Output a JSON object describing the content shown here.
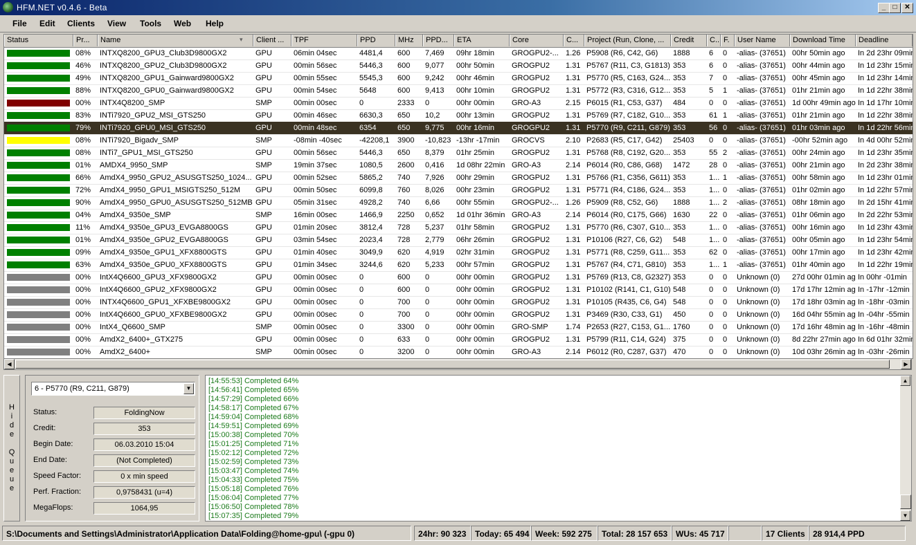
{
  "window": {
    "title": "HFM.NET v0.4.6 - Beta",
    "min": "_",
    "max": "□",
    "close": "✕"
  },
  "menu": [
    "File",
    "Edit",
    "Clients",
    "View",
    "Tools",
    "Web",
    "Help"
  ],
  "columns": [
    "Status",
    "Pr...",
    "Name",
    "Client ...",
    "TPF",
    "PPD",
    "MHz",
    "PPD...",
    "ETA",
    "Core",
    "C...",
    "Project (Run, Clone, ...",
    "Credit",
    "C...",
    "F.",
    "User Name",
    "Download Time",
    "Deadline"
  ],
  "status_colors": {
    "green": "#008000",
    "red": "#800000",
    "yellow": "#ffff00",
    "gray": "#808080"
  },
  "rows": [
    {
      "status": "green",
      "pr": "08%",
      "name": "INTXQ8200_GPU3_Club3D9800GX2",
      "client": "GPU",
      "tpf": "06min 04sec",
      "ppd": "4481,4",
      "mhz": "600",
      "ppdmhz": "7,469",
      "eta": "09hr 18min",
      "core": "GROGPU2-...",
      "cv": "1.26",
      "project": "P5908 (R6, C42, G6)",
      "credit": "1888",
      "c": "6",
      "f": "0",
      "user": "-alias- (37651)",
      "download": "00hr 50min ago",
      "deadline": "In 2d 23hr 09min"
    },
    {
      "status": "green",
      "pr": "46%",
      "name": "INTXQ8200_GPU2_Club3D9800GX2",
      "client": "GPU",
      "tpf": "00min 56sec",
      "ppd": "5446,3",
      "mhz": "600",
      "ppdmhz": "9,077",
      "eta": "00hr 50min",
      "core": "GROGPU2",
      "cv": "1.31",
      "project": "P5767 (R11, C3, G1813)",
      "credit": "353",
      "c": "6",
      "f": "0",
      "user": "-alias- (37651)",
      "download": "00hr 44min ago",
      "deadline": "In 1d 23hr 15min"
    },
    {
      "status": "green",
      "pr": "49%",
      "name": "INTXQ8200_GPU1_Gainward9800GX2",
      "client": "GPU",
      "tpf": "00min 55sec",
      "ppd": "5545,3",
      "mhz": "600",
      "ppdmhz": "9,242",
      "eta": "00hr 46min",
      "core": "GROGPU2",
      "cv": "1.31",
      "project": "P5770 (R5, C163, G24...",
      "credit": "353",
      "c": "7",
      "f": "0",
      "user": "-alias- (37651)",
      "download": "00hr 45min ago",
      "deadline": "In 1d 23hr 14min"
    },
    {
      "status": "green",
      "pr": "88%",
      "name": "INTXQ8200_GPU0_Gainward9800GX2",
      "client": "GPU",
      "tpf": "00min 54sec",
      "ppd": "5648",
      "mhz": "600",
      "ppdmhz": "9,413",
      "eta": "00hr 10min",
      "core": "GROGPU2",
      "cv": "1.31",
      "project": "P5772 (R3, C316, G12...",
      "credit": "353",
      "c": "5",
      "f": "1",
      "user": "-alias- (37651)",
      "download": "01hr 21min ago",
      "deadline": "In 1d 22hr 38min"
    },
    {
      "status": "red",
      "pr": "00%",
      "name": "INTX4Q8200_SMP",
      "client": "SMP",
      "tpf": "00min 00sec",
      "ppd": "0",
      "mhz": "2333",
      "ppdmhz": "0",
      "eta": "00hr 00min",
      "core": "GRO-A3",
      "cv": "2.15",
      "project": "P6015 (R1, C53, G37)",
      "credit": "484",
      "c": "0",
      "f": "0",
      "user": "-alias- (37651)",
      "download": "1d 00hr 49min ago",
      "deadline": "In 1d 17hr 10min"
    },
    {
      "status": "green",
      "pr": "83%",
      "name": "INTi7920_GPU2_MSI_GTS250",
      "client": "GPU",
      "tpf": "00min 46sec",
      "ppd": "6630,3",
      "mhz": "650",
      "ppdmhz": "10,2",
      "eta": "00hr 13min",
      "core": "GROGPU2",
      "cv": "1.31",
      "project": "P5769 (R7, C182, G10...",
      "credit": "353",
      "c": "61",
      "f": "1",
      "user": "-alias- (37651)",
      "download": "01hr 21min ago",
      "deadline": "In 1d 22hr 38min"
    },
    {
      "status": "green",
      "pr": "79%",
      "name": "INTi7920_GPU0_MSI_GTS250",
      "client": "GPU",
      "tpf": "00min 48sec",
      "ppd": "6354",
      "mhz": "650",
      "ppdmhz": "9,775",
      "eta": "00hr 16min",
      "core": "GROGPU2",
      "cv": "1.31",
      "project": "P5770 (R9, C211, G879)",
      "credit": "353",
      "c": "56",
      "f": "0",
      "user": "-alias- (37651)",
      "download": "01hr 03min ago",
      "deadline": "In 1d 22hr 56min",
      "selected": true
    },
    {
      "status": "yellow",
      "pr": "08%",
      "name": "INTi7920_Bigadv_SMP",
      "client": "SMP",
      "tpf": "-08min -40sec",
      "ppd": "-42208,1",
      "mhz": "3900",
      "ppdmhz": "-10,823",
      "eta": "-13hr -17min",
      "core": "GROCVS",
      "cv": "2.10",
      "project": "P2683 (R5, C17, G42)",
      "credit": "25403",
      "c": "0",
      "f": "0",
      "user": "-alias- (37651)",
      "download": "-00hr 52min ago",
      "deadline": "In 4d 00hr 52min"
    },
    {
      "status": "green",
      "pr": "08%",
      "name": "INTi7_GPU1_MSI_GTS250",
      "client": "GPU",
      "tpf": "00min 56sec",
      "ppd": "5446,3",
      "mhz": "650",
      "ppdmhz": "8,379",
      "eta": "01hr 25min",
      "core": "GROGPU2",
      "cv": "1.31",
      "project": "P5768 (R8, C192, G20...",
      "credit": "353",
      "c": "55",
      "f": "2",
      "user": "-alias- (37651)",
      "download": "00hr 24min ago",
      "deadline": "In 1d 23hr 35min"
    },
    {
      "status": "green",
      "pr": "01%",
      "name": "AMDX4_9950_SMP",
      "client": "SMP",
      "tpf": "19min 37sec",
      "ppd": "1080,5",
      "mhz": "2600",
      "ppdmhz": "0,416",
      "eta": "1d 08hr 22min",
      "core": "GRO-A3",
      "cv": "2.14",
      "project": "P6014 (R0, C86, G68)",
      "credit": "1472",
      "c": "28",
      "f": "0",
      "user": "-alias- (37651)",
      "download": "00hr 21min ago",
      "deadline": "In 2d 23hr 38min"
    },
    {
      "status": "green",
      "pr": "66%",
      "name": "AmdX4_9950_GPU2_ASUSGTS250_1024...",
      "client": "GPU",
      "tpf": "00min 52sec",
      "ppd": "5865,2",
      "mhz": "740",
      "ppdmhz": "7,926",
      "eta": "00hr 29min",
      "core": "GROGPU2",
      "cv": "1.31",
      "project": "P5766 (R1, C356, G611)",
      "credit": "353",
      "c": "1...",
      "f": "1",
      "user": "-alias- (37651)",
      "download": "00hr 58min ago",
      "deadline": "In 1d 23hr 01min"
    },
    {
      "status": "green",
      "pr": "72%",
      "name": "AmdX4_9950_GPU1_MSIGTS250_512M",
      "client": "GPU",
      "tpf": "00min 50sec",
      "ppd": "6099,8",
      "mhz": "760",
      "ppdmhz": "8,026",
      "eta": "00hr 23min",
      "core": "GROGPU2",
      "cv": "1.31",
      "project": "P5771 (R4, C186, G24...",
      "credit": "353",
      "c": "1...",
      "f": "0",
      "user": "-alias- (37651)",
      "download": "01hr 02min ago",
      "deadline": "In 1d 22hr 57min"
    },
    {
      "status": "green",
      "pr": "90%",
      "name": "AmdX4_9950_GPU0_ASUSGTS250_512MB",
      "client": "GPU",
      "tpf": "05min 31sec",
      "ppd": "4928,2",
      "mhz": "740",
      "ppdmhz": "6,66",
      "eta": "00hr 55min",
      "core": "GROGPU2-...",
      "cv": "1.26",
      "project": "P5909 (R8, C52, G6)",
      "credit": "1888",
      "c": "1...",
      "f": "2",
      "user": "-alias- (37651)",
      "download": "08hr 18min ago",
      "deadline": "In 2d 15hr 41min"
    },
    {
      "status": "green",
      "pr": "04%",
      "name": "AmdX4_9350e_SMP",
      "client": "SMP",
      "tpf": "16min 00sec",
      "ppd": "1466,9",
      "mhz": "2250",
      "ppdmhz": "0,652",
      "eta": "1d 01hr 36min",
      "core": "GRO-A3",
      "cv": "2.14",
      "project": "P6014 (R0, C175, G66)",
      "credit": "1630",
      "c": "22",
      "f": "0",
      "user": "-alias- (37651)",
      "download": "01hr 06min ago",
      "deadline": "In 2d 22hr 53min"
    },
    {
      "status": "green",
      "pr": "11%",
      "name": "AmdX4_9350e_GPU3_EVGA8800GS",
      "client": "GPU",
      "tpf": "01min 20sec",
      "ppd": "3812,4",
      "mhz": "728",
      "ppdmhz": "5,237",
      "eta": "01hr 58min",
      "core": "GROGPU2",
      "cv": "1.31",
      "project": "P5770 (R6, C307, G10...",
      "credit": "353",
      "c": "1...",
      "f": "0",
      "user": "-alias- (37651)",
      "download": "00hr 16min ago",
      "deadline": "In 1d 23hr 43min"
    },
    {
      "status": "green",
      "pr": "01%",
      "name": "AmdX4_9350e_GPU2_EVGA8800GS",
      "client": "GPU",
      "tpf": "03min 54sec",
      "ppd": "2023,4",
      "mhz": "728",
      "ppdmhz": "2,779",
      "eta": "06hr 26min",
      "core": "GROGPU2",
      "cv": "1.31",
      "project": "P10106 (R27, C6, G2)",
      "credit": "548",
      "c": "1...",
      "f": "0",
      "user": "-alias- (37651)",
      "download": "00hr 05min ago",
      "deadline": "In 1d 23hr 54min"
    },
    {
      "status": "green",
      "pr": "09%",
      "name": "AmdX4_9350e_GPU1_XFX8800GTS",
      "client": "GPU",
      "tpf": "01min 40sec",
      "ppd": "3049,9",
      "mhz": "620",
      "ppdmhz": "4,919",
      "eta": "02hr 31min",
      "core": "GROGPU2",
      "cv": "1.31",
      "project": "P5771 (R8, C259, G11...",
      "credit": "353",
      "c": "62",
      "f": "0",
      "user": "-alias- (37651)",
      "download": "00hr 17min ago",
      "deadline": "In 1d 23hr 42min"
    },
    {
      "status": "green",
      "pr": "63%",
      "name": "AmdX4_9350e_GPU0_XFX8800GTS",
      "client": "GPU",
      "tpf": "01min 34sec",
      "ppd": "3244,6",
      "mhz": "620",
      "ppdmhz": "5,233",
      "eta": "00hr 57min",
      "core": "GROGPU2",
      "cv": "1.31",
      "project": "P5767 (R4, C71, G810)",
      "credit": "353",
      "c": "1...",
      "f": "1",
      "user": "-alias- (37651)",
      "download": "01hr 40min ago",
      "deadline": "In 1d 22hr 19min"
    },
    {
      "status": "gray",
      "pr": "00%",
      "name": "IntX4Q6600_GPU3_XFX9800GX2",
      "client": "GPU",
      "tpf": "00min 00sec",
      "ppd": "0",
      "mhz": "600",
      "ppdmhz": "0",
      "eta": "00hr 00min",
      "core": "GROGPU2",
      "cv": "1.31",
      "project": "P5769 (R13, C8, G2327)",
      "credit": "353",
      "c": "0",
      "f": "0",
      "user": "Unknown (0)",
      "download": "27d 00hr 01min ago",
      "deadline": "In 00hr -01min"
    },
    {
      "status": "gray",
      "pr": "00%",
      "name": "IntX4Q6600_GPU2_XFX9800GX2",
      "client": "GPU",
      "tpf": "00min 00sec",
      "ppd": "0",
      "mhz": "600",
      "ppdmhz": "0",
      "eta": "00hr 00min",
      "core": "GROGPU2",
      "cv": "1.31",
      "project": "P10102 (R141, C1, G10)",
      "credit": "548",
      "c": "0",
      "f": "0",
      "user": "Unknown (0)",
      "download": "17d 17hr 12min ago",
      "deadline": "In -17hr -12min"
    },
    {
      "status": "gray",
      "pr": "00%",
      "name": "INTX4Q6600_GPU1_XFXBE9800GX2",
      "client": "GPU",
      "tpf": "00min 00sec",
      "ppd": "0",
      "mhz": "700",
      "ppdmhz": "0",
      "eta": "00hr 00min",
      "core": "GROGPU2",
      "cv": "1.31",
      "project": "P10105 (R435, C6, G4)",
      "credit": "548",
      "c": "0",
      "f": "0",
      "user": "Unknown (0)",
      "download": "17d 18hr 03min ago",
      "deadline": "In -18hr -03min"
    },
    {
      "status": "gray",
      "pr": "00%",
      "name": "IntX4Q6600_GPU0_XFXBE9800GX2",
      "client": "GPU",
      "tpf": "00min 00sec",
      "ppd": "0",
      "mhz": "700",
      "ppdmhz": "0",
      "eta": "00hr 00min",
      "core": "GROGPU2",
      "cv": "1.31",
      "project": "P3469 (R30, C33, G1)",
      "credit": "450",
      "c": "0",
      "f": "0",
      "user": "Unknown (0)",
      "download": "16d 04hr 55min ago",
      "deadline": "In -04hr -55min"
    },
    {
      "status": "gray",
      "pr": "00%",
      "name": "IntX4_Q6600_SMP",
      "client": "SMP",
      "tpf": "00min 00sec",
      "ppd": "0",
      "mhz": "3300",
      "ppdmhz": "0",
      "eta": "00hr 00min",
      "core": "GRO-SMP",
      "cv": "1.74",
      "project": "P2653 (R27, C153, G1...",
      "credit": "1760",
      "c": "0",
      "f": "0",
      "user": "Unknown (0)",
      "download": "17d 16hr 48min ago",
      "deadline": "In -16hr -48min"
    },
    {
      "status": "gray",
      "pr": "00%",
      "name": "AmdX2_6400+_GTX275",
      "client": "GPU",
      "tpf": "00min 00sec",
      "ppd": "0",
      "mhz": "633",
      "ppdmhz": "0",
      "eta": "00hr 00min",
      "core": "GROGPU2",
      "cv": "1.31",
      "project": "P5799 (R11, C14, G24)",
      "credit": "375",
      "c": "0",
      "f": "0",
      "user": "Unknown (0)",
      "download": "8d 22hr 27min ago",
      "deadline": "In 6d 01hr 32min"
    },
    {
      "status": "gray",
      "pr": "00%",
      "name": "AmdX2_6400+",
      "client": "SMP",
      "tpf": "00min 00sec",
      "ppd": "0",
      "mhz": "3200",
      "ppdmhz": "0",
      "eta": "00hr 00min",
      "core": "GRO-A3",
      "cv": "2.14",
      "project": "P6012 (R0, C287, G37)",
      "credit": "470",
      "c": "0",
      "f": "0",
      "user": "Unknown (0)",
      "download": "10d 03hr 26min ago",
      "deadline": "In -03hr -26min"
    }
  ],
  "queue": {
    "tab_label": "Hide Queue",
    "selected": "6 - P5770 (R9, C211, G879)",
    "fields": [
      {
        "label": "Status:",
        "value": "FoldingNow"
      },
      {
        "label": "Credit:",
        "value": "353"
      },
      {
        "label": "Begin Date:",
        "value": "06.03.2010 15:04"
      },
      {
        "label": "End Date:",
        "value": "(Not Completed)"
      },
      {
        "label": "Speed Factor:",
        "value": "0 x min speed"
      },
      {
        "label": "Perf. Fraction:",
        "value": "0,9758431 (u=4)"
      },
      {
        "label": "MegaFlops:",
        "value": "1064,95"
      }
    ]
  },
  "log": [
    "[14:55:53] Completed 64%",
    "[14:56:41] Completed 65%",
    "[14:57:29] Completed 66%",
    "[14:58:17] Completed 67%",
    "[14:59:04] Completed 68%",
    "[14:59:51] Completed 69%",
    "[15:00:38] Completed 70%",
    "[15:01:25] Completed 71%",
    "[15:02:12] Completed 72%",
    "[15:02:59] Completed 73%",
    "[15:03:47] Completed 74%",
    "[15:04:33] Completed 75%",
    "[15:05:18] Completed 76%",
    "[15:06:04] Completed 77%",
    "[15:06:50] Completed 78%",
    "[15:07:35] Completed 79%"
  ],
  "statusbar": {
    "path": "S:\\Documents and Settings\\Administrator\\Application Data\\Folding@home-gpu\\ (-gpu 0)",
    "h24": "24hr: 90 323",
    "today": "Today: 65 494",
    "week": "Week: 592 275",
    "total": "Total: 28 157 653",
    "wus": "WUs: 45 717",
    "clients": "17 Clients",
    "ppd": "28 914,4 PPD"
  }
}
